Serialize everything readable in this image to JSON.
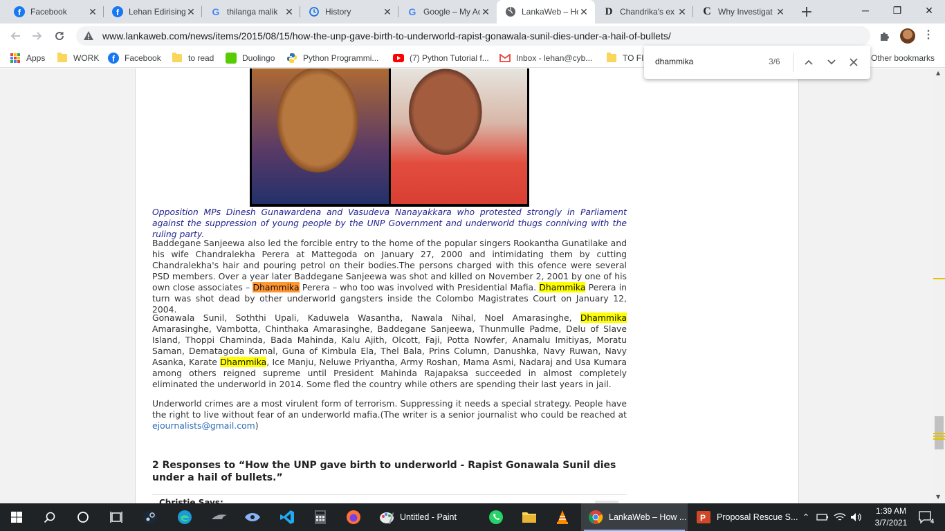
{
  "browser": {
    "tabs": [
      {
        "label": "Facebook",
        "icon": "facebook-icon"
      },
      {
        "label": "Lehan Edirisinghe",
        "icon": "facebook-icon"
      },
      {
        "label": "thilanga malik",
        "icon": "google-icon"
      },
      {
        "label": "History",
        "icon": "history-icon"
      },
      {
        "label": "Google – My Activity",
        "icon": "google-icon"
      },
      {
        "label": "LankaWeb – How the UNP",
        "icon": "globe-icon"
      },
      {
        "label": "Chandrika's ex",
        "icon": "d-icon"
      },
      {
        "label": "Why Investigat",
        "icon": "c-icon"
      }
    ],
    "new_tab": "+",
    "window": {
      "minimize": "─",
      "restore": "❐",
      "close": "✕"
    },
    "url": "www.lankaweb.com/news/items/2015/08/15/how-the-unp-gave-birth-to-underworld-rapist-gonawala-sunil-dies-under-a-hail-of-bullets/",
    "bookmarks": [
      {
        "label": "Apps"
      },
      {
        "label": "WORK"
      },
      {
        "label": "Facebook"
      },
      {
        "label": "to read"
      },
      {
        "label": "Duolingo"
      },
      {
        "label": "Python Programmi..."
      },
      {
        "label": "(7) Python Tutorial f..."
      },
      {
        "label": "Inbox - lehan@cyb..."
      },
      {
        "label": "TO FI"
      },
      {
        "label": "Other bookmarks"
      }
    ]
  },
  "find": {
    "query": "dhammika",
    "count": "3/6"
  },
  "article": {
    "caption": "Opposition MPs Dinesh Gunawardena and Vasudeva Nanayakkara who protested strongly in Parliament against the suppression of young people by the UNP Government and underworld thugs conniving with the ruling party.",
    "p1": {
      "a": "Baddegane Sanjeewa also led the forcible entry to the home of the popular singers Rookantha Gunatilake and his wife Chandralekha Perera at Mattegoda on January 27, 2000 and intimidating them by cutting Chandralekha's hair and pouring petrol on their bodies.The persons charged with this ofence were several PSD members. Over a year later Baddegane Sanjeewa was shot and killed on November 2, 2001 by one of his own close associates – ",
      "m1": "Dhammika",
      "b": " Perera – who too was  involved with Presidential Mafia. ",
      "m2": "Dhammika",
      "c": " Perera in turn was shot dead by other underworld gangsters inside the Colombo Magistrates Court on January 12, 2004."
    },
    "p2": {
      "a": "Gonawala Sunil, Soththi Upali, Kaduwela Wasantha, Nawala Nihal, Noel Amarasinghe, ",
      "m1": "Dhammika",
      "b": " Amarasinghe, Vambotta, Chinthaka Amarasinghe, Baddegane Sanjeewa, Thunmulle Padme, Delu of Slave Island, Thoppi Chaminda, Bada Mahinda, Kalu Ajith, Olcott, Faji, Potta Nowfer, Anamalu Imitiyas, Moratu Saman, Dematagoda Kamal, Guna of Kimbula Ela, Thel Bala, Prins Column, Danushka, Navy Ruwan, Navy Asanka, Karate ",
      "m2": "Dhammika",
      "c": ", Ice Manju, Neluwe Priyantha, Army Roshan, Mama Asmi, Nadaraj and Usa Kumara among others reigned supreme until President Mahinda Rajapaksa succeeded in almost completely eliminated the underworld in 2014.  Some fled the country while others are spending their last years in jail."
    },
    "p3": {
      "a": "Underworld crimes are a most virulent form of terrorism.  Suppressing it needs a special strategy. People have the right to live without fear of an underworld mafia.(The writer is a senior journalist who could be reached at ",
      "link": "ejournalists@gmail.com",
      "b": ")"
    },
    "responses_heading": "2 Responses to “How the UNP gave birth to underworld - Rapist Gonawala Sunil dies under a hail of bullets.”",
    "comment_author": "Christie Says:"
  },
  "taskbar": {
    "apps": [
      {
        "label": "Untitled - Paint"
      },
      {
        "label": "LankaWeb – How ..."
      },
      {
        "label": "Proposal Rescue S..."
      }
    ],
    "time": "1:39 AM",
    "date": "3/7/2021",
    "notifications": "4"
  },
  "colors": {
    "highlight": "#ffff00",
    "current_match": "#ff9632",
    "caption": "#22238f",
    "link": "#2a6ab8"
  }
}
